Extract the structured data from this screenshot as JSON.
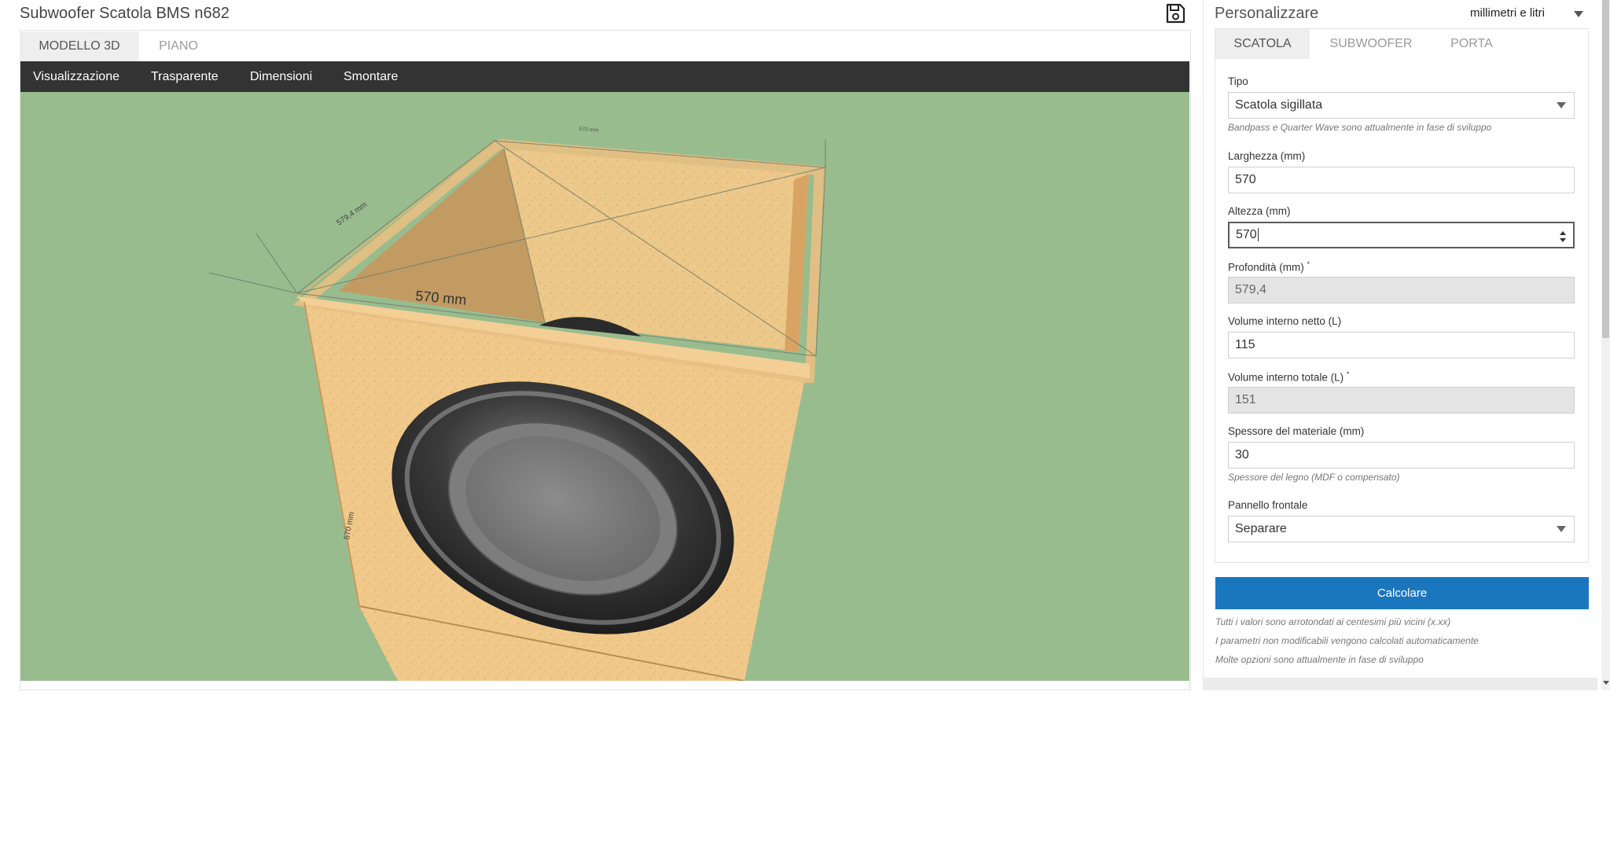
{
  "app": {
    "title": "Subwoofer Scatola BMS n682"
  },
  "viewer": {
    "tabs": [
      "MODELLO 3D",
      "PIANO"
    ],
    "menu": [
      "Visualizzazione",
      "Trasparente",
      "Dimensioni",
      "Smontare"
    ],
    "dimension_labels": {
      "front_width": "570 mm",
      "side_depth": "579,4 mm",
      "height": "570 mm",
      "top_width": "570 mm"
    }
  },
  "panel": {
    "title": "Personalizzare",
    "units": "millimetri e litri",
    "tabs": [
      "SCATOLA",
      "SUBWOOFER",
      "PORTA"
    ],
    "fields": {
      "type_label": "Tipo",
      "type_value": "Scatola sigillata",
      "type_hint": "Bandpass e Quarter Wave sono attualmente in fase di sviluppo",
      "width_label": "Larghezza (mm)",
      "width_value": "570",
      "height_label": "Altezza (mm)",
      "height_value": "570",
      "depth_label": "Profondità (mm)",
      "depth_value": "579,4",
      "net_volume_label": "Volume interno netto (L)",
      "net_volume_value": "115",
      "total_volume_label": "Volume interno totale (L)",
      "total_volume_value": "151",
      "thickness_label": "Spessore del materiale (mm)",
      "thickness_value": "30",
      "thickness_hint": "Spessore del legno (MDF o compensato)",
      "front_panel_label": "Pannello frontale",
      "front_panel_value": "Separare",
      "asterisk": "*"
    },
    "calculate": "Calcolare",
    "notes": [
      "Tutti i valori sono arrotondati ai centesimi più vicini (x.xx)",
      "I parametri non modificabili vengono calcolati automaticamente",
      "Molte opzioni sono attualmente in fase di sviluppo"
    ]
  },
  "colors": {
    "viewport_bg": "#99bc8f",
    "menubar_bg": "#333333",
    "accent": "#1a77be",
    "wood": "#f0c98a"
  }
}
